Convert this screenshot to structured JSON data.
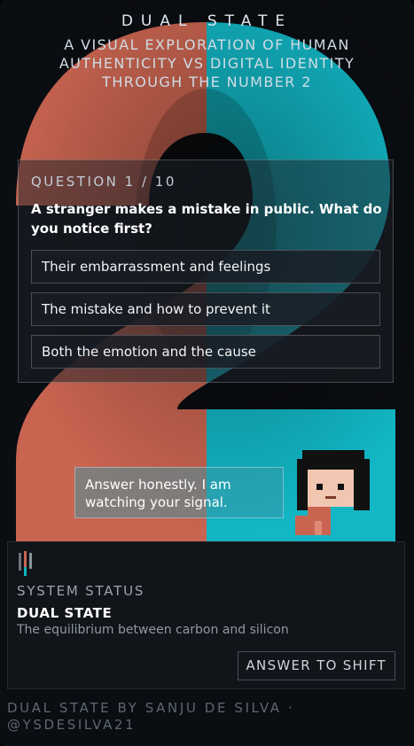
{
  "header": {
    "title": "DUAL STATE",
    "subtitle": "A VISUAL EXPLORATION OF HUMAN AUTHENTICITY VS DIGITAL IDENTITY THROUGH THE NUMBER 2"
  },
  "background": {
    "glyph": "2",
    "colors": {
      "human": "#c86450",
      "digital": "#12b6c4"
    }
  },
  "question": {
    "counter": "QUESTION 1 / 10",
    "text": "A stranger makes a mistake in public. What do you notice first?",
    "options": [
      "Their embarrassment and feelings",
      "The mistake and how to prevent it",
      "Both the emotion and the cause"
    ]
  },
  "companion": {
    "speech": "Answer honestly. I am watching your signal.",
    "icon": "pixel-avatar-icon"
  },
  "status": {
    "icon": "signal-bars-icon",
    "label": "SYSTEM STATUS",
    "name": "DUAL STATE",
    "description": "The equilibrium between carbon and silicon",
    "button": "ANSWER TO SHIFT"
  },
  "footer": {
    "credit": "DUAL STATE BY SANJU DE SILVA · @YSDESILVA21"
  }
}
